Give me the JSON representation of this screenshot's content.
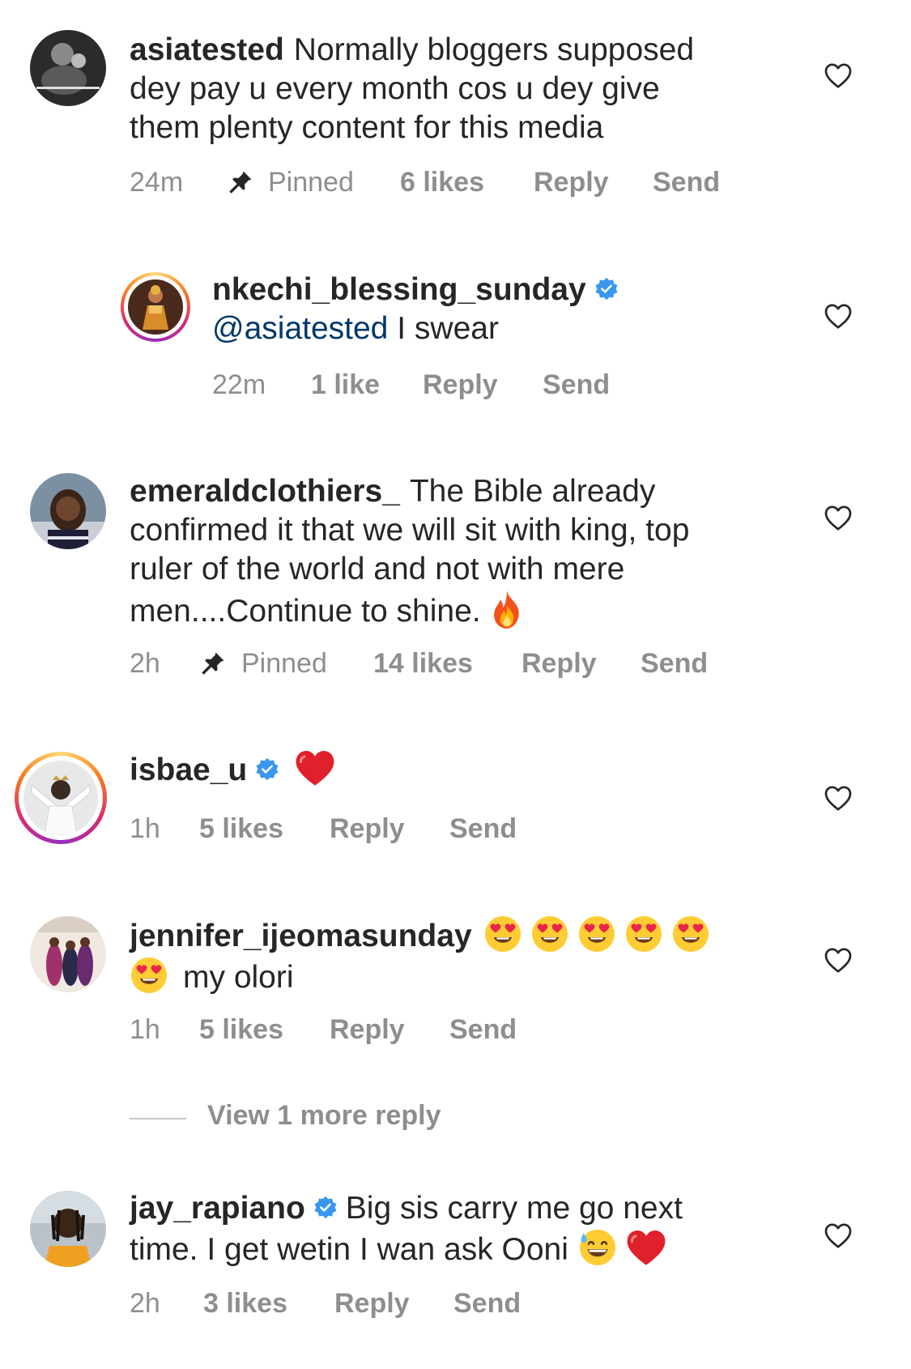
{
  "comments": [
    {
      "username": "asiatested",
      "verified": false,
      "text_lines": [
        "Normally bloggers supposed",
        "dey pay u every month cos u dey give",
        "them plenty content for this media"
      ],
      "time": "24m",
      "pinned_label": "Pinned",
      "likes": "6 likes",
      "reply": "Reply",
      "send": "Send"
    },
    {
      "username": "nkechi_blessing_sunday",
      "verified": true,
      "mention": "@asiatested",
      "text": "I swear",
      "time": "22m",
      "likes": "1 like",
      "reply": "Reply",
      "send": "Send"
    },
    {
      "username": "emeraldclothiers_",
      "verified": false,
      "text_lines": [
        "The Bible already",
        "confirmed it that we will sit with king, top",
        "ruler of the world and not with mere",
        "men....Continue to shine."
      ],
      "time": "2h",
      "pinned_label": "Pinned",
      "likes": "14 likes",
      "reply": "Reply",
      "send": "Send"
    },
    {
      "username": "isbae_u",
      "verified": true,
      "time": "1h",
      "likes": "5 likes",
      "reply": "Reply",
      "send": "Send"
    },
    {
      "username": "jennifer_ijeomasunday",
      "verified": false,
      "text": "my olori",
      "time": "1h",
      "likes": "5 likes",
      "reply": "Reply",
      "send": "Send"
    },
    {
      "username": "jay_rapiano",
      "verified": true,
      "text_lines": [
        "Big sis carry me go next",
        "time. I get wetin I wan ask Ooni"
      ],
      "time": "2h",
      "likes": "3 likes",
      "reply": "Reply",
      "send": "Send"
    }
  ],
  "view_more_replies": "View 1 more reply",
  "icons": {
    "heart": "heart-outline-icon",
    "pin": "pin-icon",
    "verified": "verified-badge-icon",
    "fire": "fire-emoji",
    "red_heart": "red-heart-emoji",
    "heart_eyes": "heart-eyes-emoji",
    "sweat_smile": "grinning-sweat-emoji"
  },
  "colors": {
    "text": "#262626",
    "secondary": "#8e8e8e",
    "mention": "#00376b",
    "verified": "#3897f0"
  }
}
